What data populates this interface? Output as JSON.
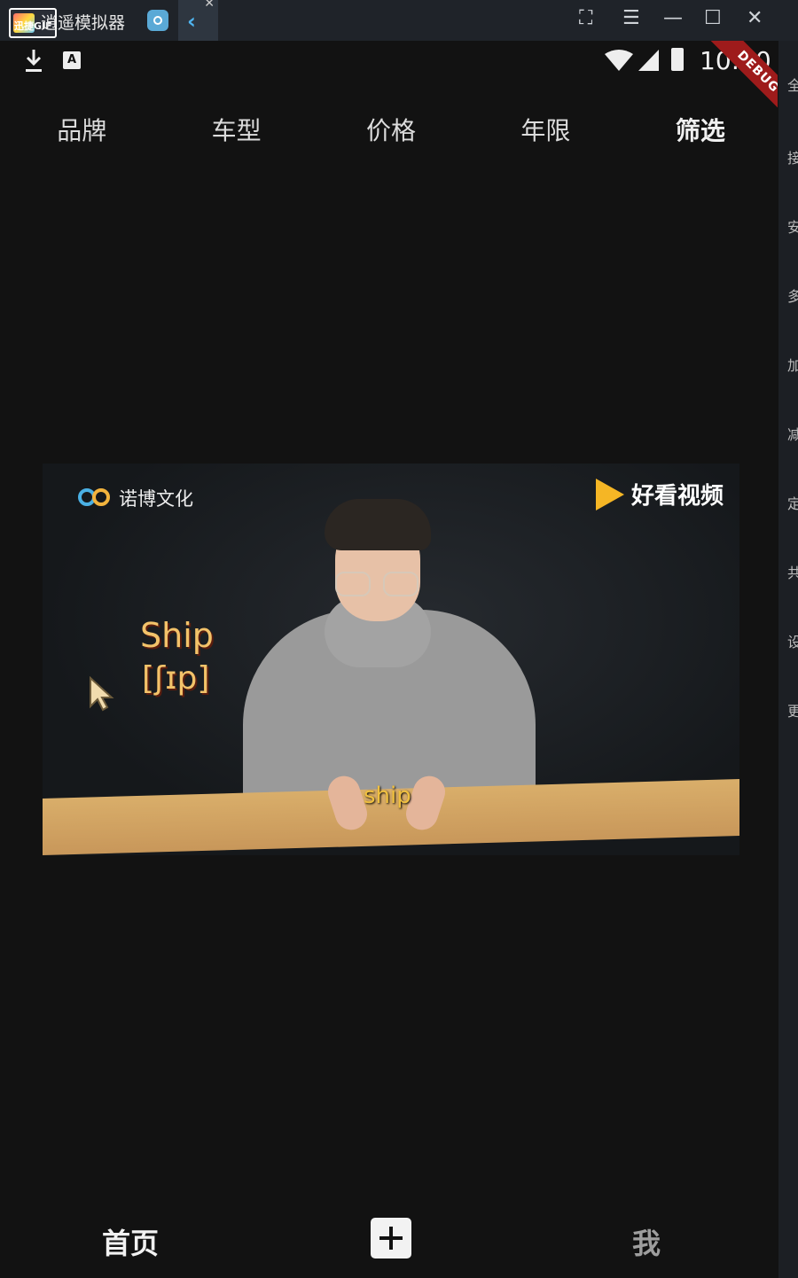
{
  "window": {
    "title": "逍遥模拟器",
    "watermark": "迅捷GIF",
    "tab_flutter_glyph": "‹",
    "controls": {
      "fullscreen": "⛶",
      "menu": "☰",
      "minimize": "—",
      "maximize": "☐",
      "close": "✕"
    }
  },
  "status_bar": {
    "time": "10:20",
    "debug_label": "DEBUG"
  },
  "filter_bar": {
    "items": [
      {
        "label": "品牌"
      },
      {
        "label": "车型"
      },
      {
        "label": "价格"
      },
      {
        "label": "年限"
      },
      {
        "label": "筛选"
      }
    ]
  },
  "video": {
    "brand_left": "诺博文化",
    "brand_right": "好看视频",
    "word": "Ship",
    "phonetic": "[ʃɪp]",
    "subtitle": "ship"
  },
  "bottom_nav": {
    "home_label": "首页",
    "me_label": "我"
  },
  "sidebar": {
    "items": [
      "全",
      "接",
      "安",
      "多",
      "加",
      "减",
      "定",
      "共",
      "设",
      "更"
    ]
  },
  "colors": {
    "background": "#121212",
    "debug_ribbon": "#9e1b1b",
    "video_text_accent": "#f3c36a"
  }
}
